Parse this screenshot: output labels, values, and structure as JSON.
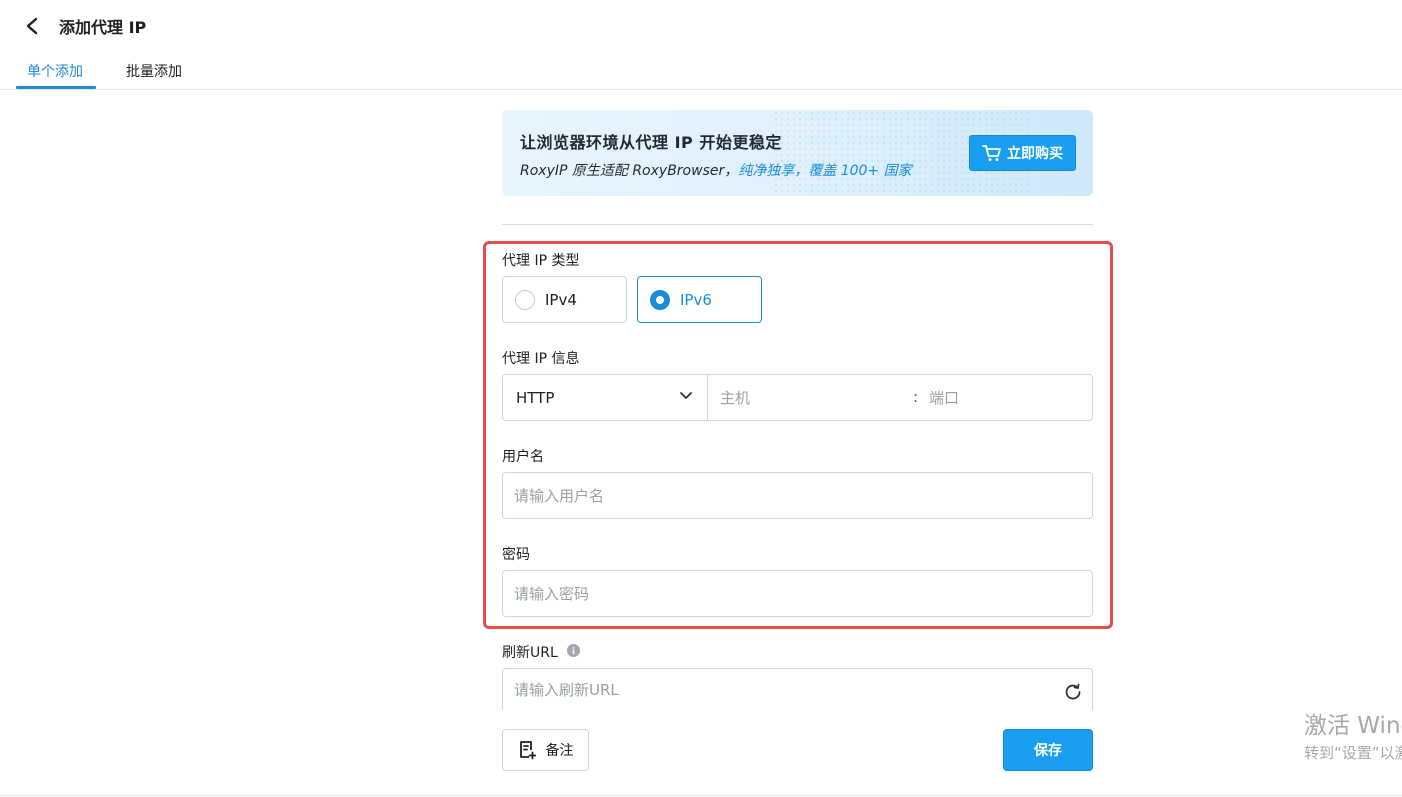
{
  "header": {
    "title": "添加代理 IP",
    "tabs": [
      {
        "label": "单个添加",
        "active": true
      },
      {
        "label": "批量添加",
        "active": false
      }
    ]
  },
  "banner": {
    "title": "让浏览器环境从代理 IP 开始更稳定",
    "subtitle_prefix": "RoxyIP 原生适配 RoxyBrowser，",
    "subtitle_highlight": "纯净独享，覆盖 100+ 国家",
    "buy_label": "立即购买"
  },
  "form": {
    "ip_type": {
      "label": "代理 IP 类型",
      "options": [
        {
          "label": "IPv4",
          "selected": false
        },
        {
          "label": "IPv6",
          "selected": true
        }
      ]
    },
    "ip_info": {
      "label": "代理 IP 信息",
      "protocol": "HTTP",
      "host_placeholder": "主机",
      "separator": ":",
      "port_placeholder": "端口"
    },
    "username": {
      "label": "用户名",
      "placeholder": "请输入用户名"
    },
    "password": {
      "label": "密码",
      "placeholder": "请输入密码"
    },
    "refresh_url": {
      "label": "刷新URL",
      "placeholder": "请输入刷新URL"
    }
  },
  "footer": {
    "note_label": "备注",
    "save_label": "保存"
  },
  "watermark": {
    "line1": "激活 Windows",
    "line2": "转到“设置”以激活 Windows。"
  },
  "colors": {
    "accent": "#1a8cd8",
    "button": "#1a9ff0",
    "highlight_border": "#e94a4a"
  }
}
